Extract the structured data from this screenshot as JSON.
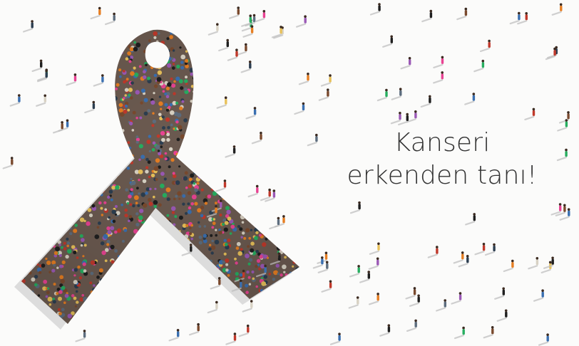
{
  "slogan": {
    "line1": "Kanseri",
    "line2": "erkenden tanı!"
  },
  "colors": {
    "background": "#fbfbfa",
    "text": "#333333",
    "crowd_palette": [
      "#c0392b",
      "#2c3e50",
      "#e8c15a",
      "#3a6fb0",
      "#7a4a2e",
      "#d8d2c4",
      "#1f1f1f",
      "#9b59b6",
      "#e67e22",
      "#5d6d7e",
      "#e84393",
      "#27ae60"
    ]
  },
  "icons": [
    "awareness-ribbon-icon",
    "person-figure-icon"
  ]
}
